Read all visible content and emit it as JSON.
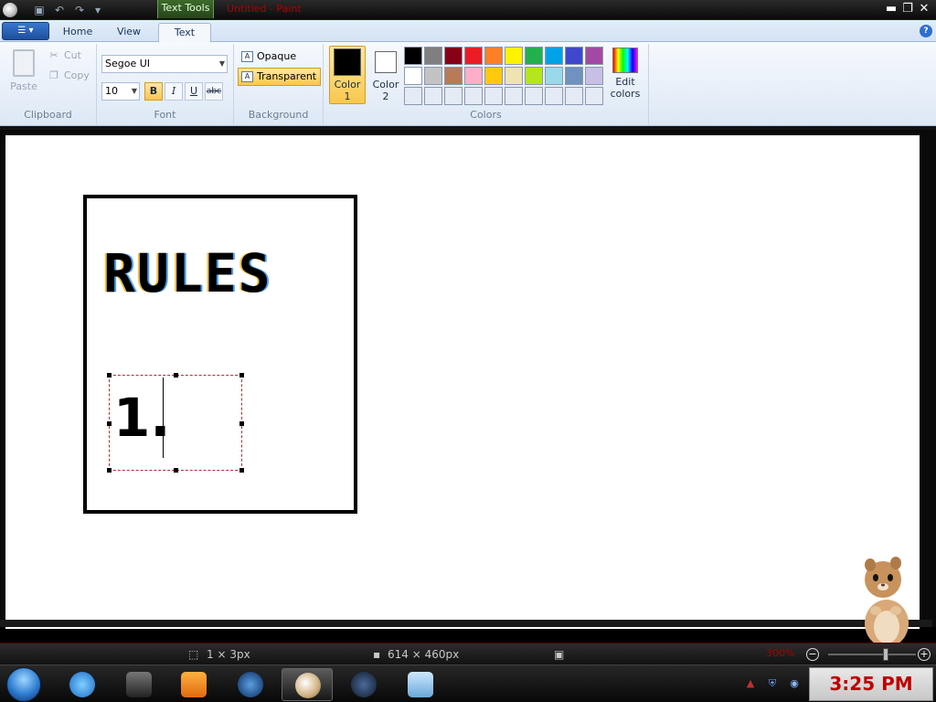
{
  "titlebar": {
    "context_tab": "Text Tools",
    "document_title": "Untitled - Paint",
    "minimize": "▬",
    "restore": "❐",
    "close": "✕"
  },
  "tabs": [
    {
      "label": "Home"
    },
    {
      "label": "View"
    },
    {
      "label": "Text"
    }
  ],
  "clipboard": {
    "paste": "Paste",
    "cut": "Cut",
    "copy": "Copy",
    "group": "Clipboard"
  },
  "font": {
    "family": "Segoe UI",
    "size": "10",
    "bold": "B",
    "italic": "I",
    "underline": "U",
    "strike": "abc",
    "group": "Font"
  },
  "background": {
    "opaque": "Opaque",
    "transparent": "Transparent",
    "group": "Background"
  },
  "colors": {
    "color1_line1": "Color",
    "color1_line2": "1",
    "color2_line1": "Color",
    "color2_line2": "2",
    "color1": "#000000",
    "color2": "#ffffff",
    "edit_line1": "Edit",
    "edit_line2": "colors",
    "group": "Colors",
    "palette": [
      "#000000",
      "#7f7f7f",
      "#880015",
      "#ed1c24",
      "#ff7f27",
      "#fff200",
      "#22b14c",
      "#00a2e8",
      "#3f48cc",
      "#a349a4",
      "#ffffff",
      "#c3c3c3",
      "#b97a57",
      "#ffaec9",
      "#ffc90e",
      "#efe4b0",
      "#b5e61d",
      "#99d9ea",
      "#7092be",
      "#c8bfe7",
      "#e4ebf4",
      "#e4ebf4",
      "#e4ebf4",
      "#e4ebf4",
      "#e4ebf4",
      "#e4ebf4",
      "#e4ebf4",
      "#e4ebf4",
      "#e4ebf4",
      "#e4ebf4"
    ]
  },
  "canvas": {
    "heading": "RULES",
    "text_entry": "1."
  },
  "statusbar": {
    "selection_size": "1 × 3px",
    "image_size": "614 × 460px",
    "zoom": "300%"
  },
  "taskbar": {
    "clock": "3:25 PM"
  }
}
